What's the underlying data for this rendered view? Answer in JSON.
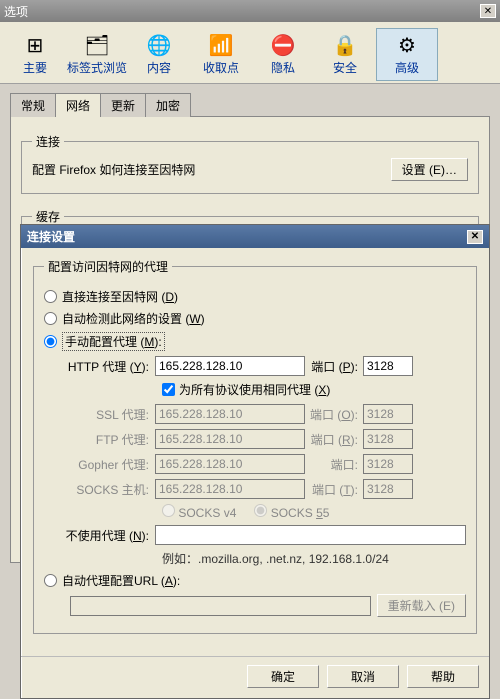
{
  "window": {
    "title": "选项"
  },
  "toolbar": [
    {
      "icon": "⊞",
      "label": "主要"
    },
    {
      "icon": "🗂",
      "label": "标签式浏览"
    },
    {
      "icon": "🌐",
      "label": "内容"
    },
    {
      "icon": "📶",
      "label": "收取点"
    },
    {
      "icon": "⛔",
      "label": "隐私"
    },
    {
      "icon": "🔒",
      "label": "安全"
    },
    {
      "icon": "⚙",
      "label": "高级",
      "selected": true
    }
  ],
  "tabs": {
    "items": [
      "常规",
      "网络",
      "更新",
      "加密"
    ],
    "active": 1
  },
  "connection": {
    "legend": "连接",
    "desc": "配置 Firefox 如何连接至因特网",
    "settings_btn": "设置 (E)…"
  },
  "cache": {
    "legend": "缓存"
  },
  "dlg": {
    "title": "连接设置",
    "fieldset_legend": "配置访问因特网的代理",
    "radios": {
      "direct": {
        "label": "直接连接至因特网 (",
        "accel": "D",
        "tail": ")"
      },
      "auto_detect": {
        "label": "自动检测此网络的设置 (",
        "accel": "W",
        "tail": ")"
      },
      "manual": {
        "label": "手动配置代理 (",
        "accel": "M",
        "tail": "):"
      },
      "auto_url": {
        "label": "自动代理配置URL (",
        "accel": "A",
        "tail": "):"
      }
    },
    "rows": {
      "http": {
        "lbl": "HTTP 代理 (",
        "acc": "Y",
        "host": "165.228.128.10",
        "portlbl": "端口 (",
        "pacc": "P",
        "port": "3128"
      },
      "shared": {
        "label": "为所有协议使用相同代理 (",
        "acc": "X",
        "tail": ")",
        "checked": true
      },
      "ssl": {
        "lbl": "SSL 代理:",
        "host": "165.228.128.10",
        "portlbl": "端口 (",
        "pacc": "O",
        "port": "3128"
      },
      "ftp": {
        "lbl": "FTP 代理:",
        "host": "165.228.128.10",
        "portlbl": "端口 (",
        "pacc": "R",
        "port": "3128"
      },
      "gopher": {
        "lbl": "Gopher 代理:",
        "host": "165.228.128.10",
        "portlbl": "端口:",
        "port": "3128"
      },
      "socks": {
        "lbl": "SOCKS 主机:",
        "host": "165.228.128.10",
        "portlbl": "端口 (",
        "pacc": "T",
        "port": "3128"
      },
      "noproxy": {
        "lbl": "不使用代理 (",
        "acc": "N",
        "val": ""
      },
      "example": "例如：.mozilla.org, .net.nz, 192.168.1.0/24"
    },
    "socksver": {
      "v4": "SOCKS v4",
      "v5": "SOCKS v5",
      "acc4": "4",
      "acc5": "5"
    },
    "reload_btn": "重新载入 (E)",
    "footer": {
      "ok": "确定",
      "cancel": "取消",
      "help": "帮助"
    }
  }
}
